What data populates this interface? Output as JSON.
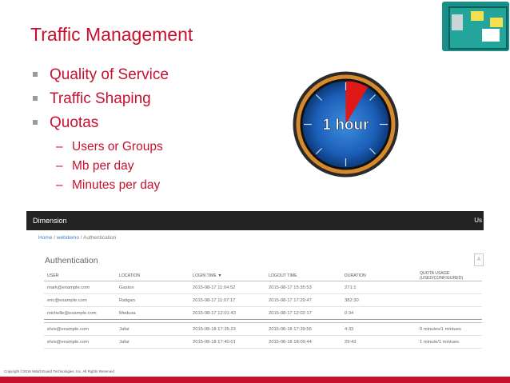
{
  "slide": {
    "title": "Traffic Management",
    "bullets": [
      "Quality of Service",
      "Traffic Shaping",
      "Quotas"
    ],
    "sub_bullets": [
      "Users or Groups",
      "Mb per day",
      "Minutes per day"
    ],
    "clock_label": "1 hour",
    "copyright": "Copyright ©2016 WatchGuard Technologies, Inc. All Rights Reserved"
  },
  "colors": {
    "accent_red": "#c8102e",
    "clock_blue": "#1c5fb8",
    "clock_ring": "#d7892d",
    "dashboard_header": "#232323"
  },
  "dashboard": {
    "header_title": "Dimension",
    "header_user": "Us",
    "breadcrumb": [
      "Home",
      "/",
      "webdemo",
      "/",
      "Authentication"
    ],
    "section_title": "Authentication",
    "search_placeholder": "A",
    "columns": [
      "USER",
      "LOCATION",
      "LOGIN TIME ▼",
      "LOGOUT TIME",
      "DURATION",
      "QUOTA USAGE (USED/CONFIGURED)"
    ],
    "rows": [
      [
        "mark@example.com",
        "Gaston",
        "2015-08-17 11:04:52",
        "2015-08-17 15:35:53",
        "271:1",
        ""
      ],
      [
        "eric@example.com",
        "Ratigan",
        "2015-08-17 11:07:17",
        "2015-08-17 17:29:47",
        "382:30",
        ""
      ],
      [
        "michelle@example.com",
        "Medusa",
        "2015-08-17 12:01:43",
        "2015-08-17 12:02:17",
        "0:34",
        ""
      ]
    ],
    "rows_lower": [
      [
        "elvis@example.com",
        "Jafar",
        "2015-08-18 17:35:23",
        "2015-08-18 17:39:56",
        "4:33",
        "0 minutes/1 mintues"
      ],
      [
        "elvis@example.com",
        "Jafar",
        "2015-08-18 17:40:01",
        "2015-08-18 18:09:44",
        "29:43",
        "1 minute/1 mintues"
      ]
    ]
  }
}
